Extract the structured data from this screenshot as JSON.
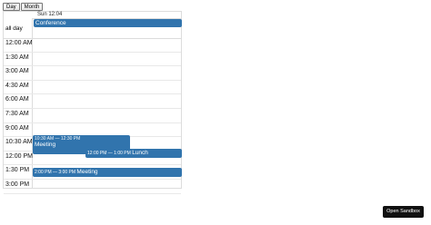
{
  "toolbar": {
    "day_label": "Day",
    "month_label": "Month"
  },
  "calendar": {
    "date_header": "Sun 12:04",
    "allday_label": "all day",
    "allday_event": "Conference",
    "time_slots": [
      "12:00 AM",
      "1:30 AM",
      "3:00 AM",
      "4:30 AM",
      "6:00 AM",
      "7:30 AM",
      "9:00 AM",
      "10:30 AM",
      "12:00 PM",
      "1:30 PM",
      "3:00 PM"
    ],
    "events": [
      {
        "time": "10:30 AM — 12:30 PM",
        "title": "Meeting"
      },
      {
        "time": "12:00 PM — 1:00 PM",
        "title": "Lunch"
      },
      {
        "time": "2:00 PM — 3:00 PM",
        "title": "Meeting"
      }
    ]
  },
  "sandbox_button": "Open Sandbox",
  "colors": {
    "event": "#3174ad",
    "border": "#dcdcdc",
    "sandbox_bg": "#111111"
  }
}
